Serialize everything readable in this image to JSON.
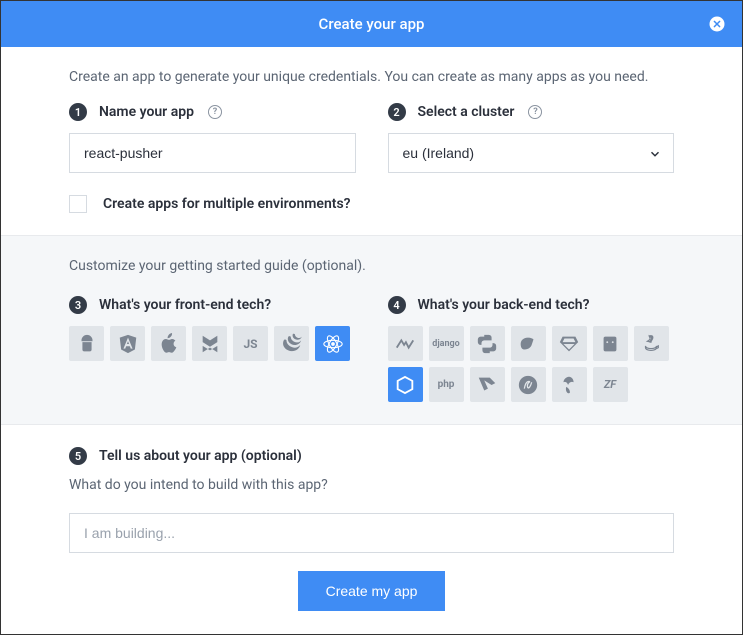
{
  "header": {
    "title": "Create your app"
  },
  "intro": "Create an app to generate your unique credentials. You can create as many apps as you need.",
  "step1": {
    "num": "1",
    "label": "Name your app",
    "value": "react-pusher"
  },
  "step2": {
    "num": "2",
    "label": "Select a cluster",
    "value": "eu (Ireland)"
  },
  "multi_env": {
    "label": "Create apps for multiple environments?"
  },
  "customize_intro": "Customize your getting started guide (optional).",
  "step3": {
    "num": "3",
    "label": "What's your front-end tech?"
  },
  "step4": {
    "num": "4",
    "label": "What's your back-end tech?"
  },
  "frontend": [
    {
      "name": "android",
      "selected": false
    },
    {
      "name": "angular",
      "selected": false
    },
    {
      "name": "ios",
      "selected": false
    },
    {
      "name": "backbone",
      "selected": false
    },
    {
      "name": "javascript",
      "selected": false
    },
    {
      "name": "jquery",
      "selected": false
    },
    {
      "name": "react",
      "selected": true
    }
  ],
  "backend": [
    {
      "name": "dotnet",
      "selected": false
    },
    {
      "name": "django",
      "selected": false
    },
    {
      "name": "python",
      "selected": false
    },
    {
      "name": "go",
      "selected": false
    },
    {
      "name": "ruby",
      "selected": false
    },
    {
      "name": "cordova",
      "selected": false
    },
    {
      "name": "java",
      "selected": false
    },
    {
      "name": "nodejs",
      "selected": true
    },
    {
      "name": "php",
      "selected": false
    },
    {
      "name": "laravel",
      "selected": false
    },
    {
      "name": "symfony",
      "selected": false
    },
    {
      "name": "yii",
      "selected": false
    },
    {
      "name": "zend",
      "selected": false
    }
  ],
  "step5": {
    "num": "5",
    "label": "Tell us about your app (optional)",
    "question": "What do you intend to build with this app?",
    "placeholder": "I am building..."
  },
  "submit_label": "Create my app"
}
